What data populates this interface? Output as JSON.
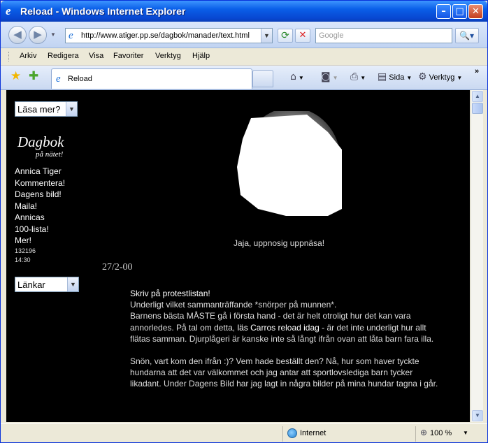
{
  "window": {
    "title": "Reload - Windows Internet Explorer",
    "minimize_glyph": "–",
    "maximize_glyph": "□",
    "close_glyph": "✕"
  },
  "addressbar": {
    "back_glyph": "◀",
    "forward_glyph": "▶",
    "url": "http://www.atiger.pp.se/dagbok/manader/text.html",
    "refresh_glyph": "⟳",
    "stop_glyph": "✕",
    "search_placeholder": "Google",
    "search_glyph": "🔍▾"
  },
  "menubar": {
    "items": [
      "Arkiv",
      "Redigera",
      "Visa",
      "Favoriter",
      "Verktyg",
      "Hjälp"
    ]
  },
  "tabbar": {
    "favorites_glyph": "★",
    "add_favorites_glyph": "✚",
    "tab_label": "Reload",
    "home_glyph": "⌂",
    "feeds_glyph": "◙",
    "print_glyph": "⎙",
    "page_label": "Sida",
    "tools_label": "Verktyg",
    "tools_glyph": "⚙",
    "more_glyph": "»"
  },
  "page": {
    "read_more_select": "Läsa mer?",
    "logo_title": "Dagbok",
    "logo_subtitle": "på nätet!",
    "nav_links": [
      "Annica Tiger",
      "Kommentera!",
      "Dagens bild!",
      "Maila!",
      "Annicas",
      "100-lista!",
      "Mer!"
    ],
    "counter": "132196",
    "time": "14:30",
    "links_select": "Länkar",
    "photo_caption": "Jaja, uppnosig uppnäsa!",
    "date": "27/2-00",
    "entry": {
      "heading": "Skriv på protestlistan!",
      "p1_line1": "Underligt vilket sammanträffande *snörper på munnen*.",
      "p1_text_a": "Barnens bästa MÅSTE gå i första hand - det är helt otroligt hur det kan vara annorledes. På tal om detta, ",
      "p1_link": "läs Carros reload idag",
      "p1_text_b": " - är det inte underligt hur allt flätas samman. Djurplågeri är kanske inte så långt ifrån ovan att låta barn fara illa.",
      "p2": "Snön, vart kom den ifrån :)? Vem hade beställt den? Nå, hur som haver tyckte hundarna att det var välkommet och jag antar att sportlovslediga barn tycker likadant. Under Dagens Bild har jag lagt in några bilder på mina hundar tagna i går."
    }
  },
  "statusbar": {
    "zone": "Internet",
    "zoom": "100 %"
  }
}
